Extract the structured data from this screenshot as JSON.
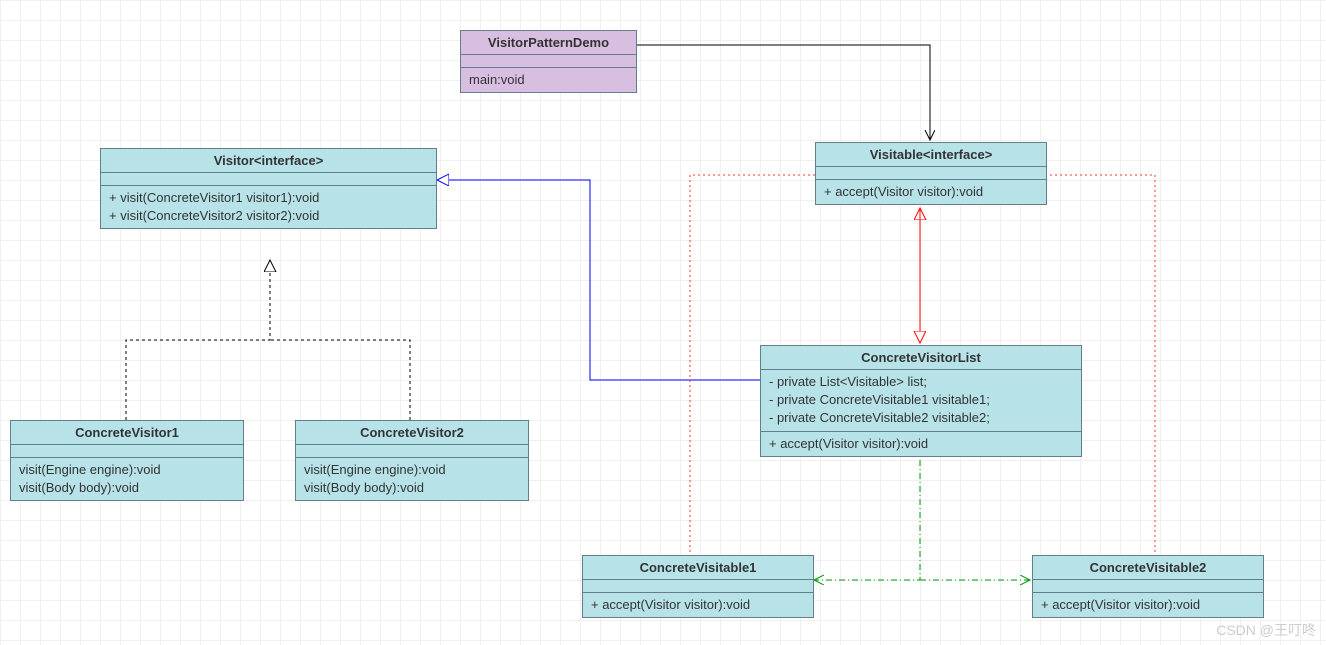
{
  "demo": {
    "title": "VisitorPatternDemo",
    "method": "main:void"
  },
  "visitor": {
    "title": "Visitor<interface>",
    "m1": "+ visit(ConcreteVisitor1 visitor1):void",
    "m2": "+ visit(ConcreteVisitor2 visitor2):void"
  },
  "visitable": {
    "title": "Visitable<interface>",
    "m1": "+ accept(Visitor visitor):void"
  },
  "cv1": {
    "title": "ConcreteVisitor1",
    "m1": "visit(Engine engine):void",
    "m2": "visit(Body body):void"
  },
  "cv2": {
    "title": "ConcreteVisitor2",
    "m1": "visit(Engine engine):void",
    "m2": "visit(Body body):void"
  },
  "cvlist": {
    "title": "ConcreteVisitorList",
    "f1": "- private List<Visitable> list;",
    "f2": "- private ConcreteVisitable1 visitable1;",
    "f3": "- private ConcreteVisitable2 visitable2;",
    "m1": "+ accept(Visitor visitor):void"
  },
  "cvis1": {
    "title": "ConcreteVisitable1",
    "m1": "+ accept(Visitor visitor):void"
  },
  "cvis2": {
    "title": "ConcreteVisitable2",
    "m1": "+ accept(Visitor visitor):void"
  },
  "watermark": "CSDN @王叮咚"
}
